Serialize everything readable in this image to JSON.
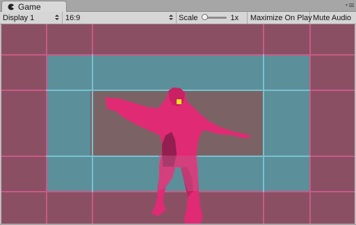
{
  "window": {
    "tab_label": "Game",
    "tab_icon": "pacman-game-icon",
    "menu_icon": "options-menu-icon"
  },
  "toolbar": {
    "display_label": "Display 1",
    "aspect_label": "16:9",
    "scale_label": "Scale",
    "scale_value": "1x",
    "scale_slider_fraction": 0.0,
    "maximize_label": "Maximize On Play",
    "mute_label": "Mute Audio"
  },
  "colors": {
    "viewport_bg": "#8b4f63",
    "pink_grid": "#c83a74",
    "blue_grid": "#66b8c8",
    "inner_rect": "#7c6466",
    "teal_rect": "#5b8f99",
    "figure": "#e12c74",
    "marker": "#f2e21b"
  }
}
